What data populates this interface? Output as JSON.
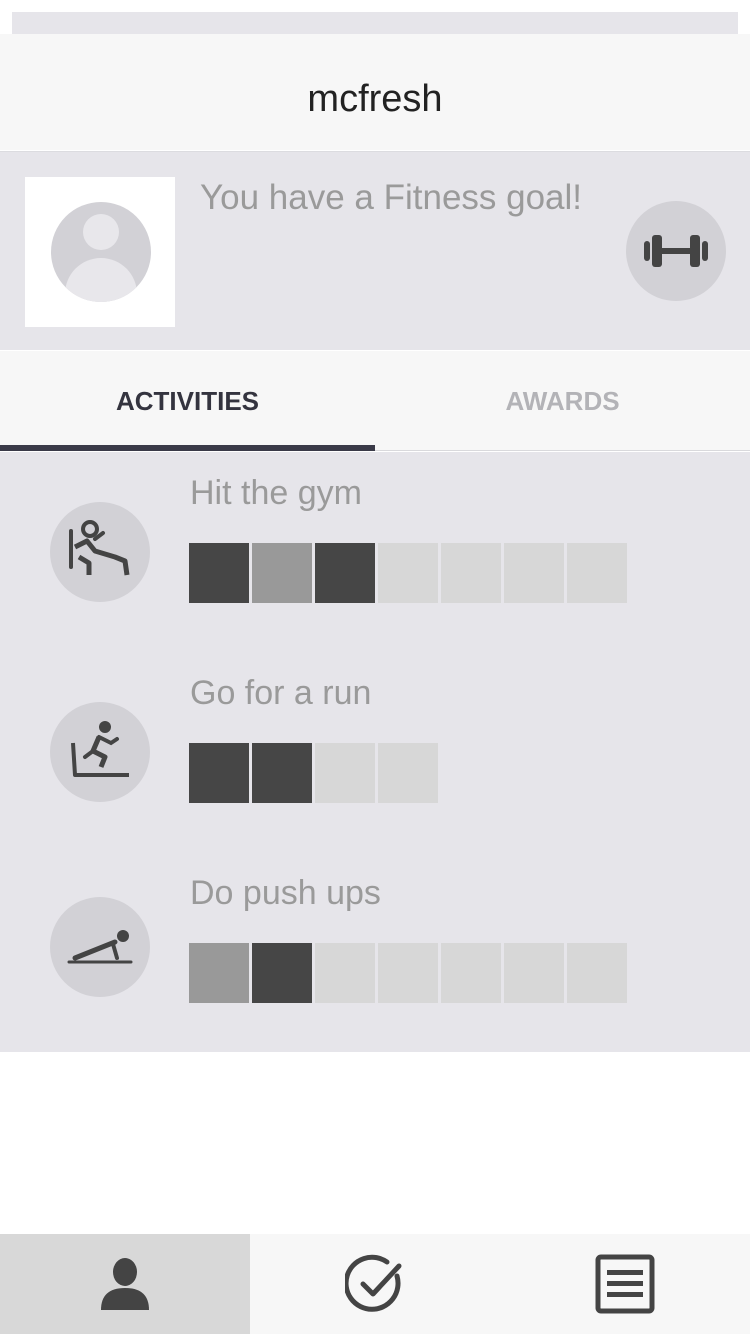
{
  "header": {
    "title": "mcfresh"
  },
  "goal": {
    "text": "You have a Fitness goal!",
    "avatar_icon": "user-placeholder-icon",
    "icon": "dumbbell-icon"
  },
  "tabs": [
    {
      "label": "ACTIVITIES",
      "active": true
    },
    {
      "label": "AWARDS",
      "active": false
    }
  ],
  "activities": [
    {
      "title": "Hit the gym",
      "icon": "gym-workout-icon",
      "progress": [
        "done",
        "partial",
        "done",
        "todo",
        "todo",
        "todo",
        "todo"
      ]
    },
    {
      "title": "Go for a run",
      "icon": "treadmill-run-icon",
      "progress": [
        "done",
        "done",
        "todo",
        "todo"
      ]
    },
    {
      "title": "Do push ups",
      "icon": "push-up-icon",
      "progress": [
        "partial",
        "done",
        "todo",
        "todo",
        "todo",
        "todo",
        "todo"
      ]
    }
  ],
  "bottom_nav": [
    {
      "icon": "profile-icon",
      "active": true
    },
    {
      "icon": "checkmark-icon",
      "active": false
    },
    {
      "icon": "list-icon",
      "active": false
    }
  ],
  "colors": {
    "done": "#464646",
    "partial": "#999999",
    "todo": "#d7d7d7",
    "accent": "#3a3a48"
  }
}
